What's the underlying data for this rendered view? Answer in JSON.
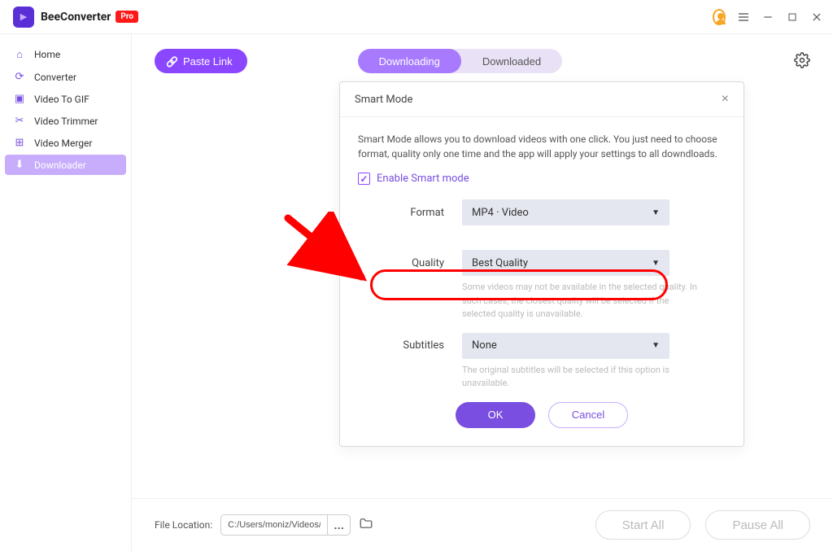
{
  "app": {
    "name": "BeeConverter",
    "badge": "Pro"
  },
  "sidebar": {
    "items": [
      {
        "label": "Home"
      },
      {
        "label": "Converter"
      },
      {
        "label": "Video To GIF"
      },
      {
        "label": "Video Trimmer"
      },
      {
        "label": "Video Merger"
      },
      {
        "label": "Downloader"
      }
    ]
  },
  "toolbar": {
    "paste_label": "Paste Link",
    "tab_downloading": "Downloading",
    "tab_downloaded": "Downloaded"
  },
  "modal": {
    "title": "Smart Mode",
    "description": "Smart Mode allows you to download videos with one click. You just need to choose format, quality only one time and the app will apply your settings to all downdloads.",
    "enable_label": "Enable Smart mode",
    "format_label": "Format",
    "format_value": "MP4 · Video",
    "quality_label": "Quality",
    "quality_value": "Best Quality",
    "quality_help": "Some videos may not be available in the selected quality. In such cases, the closest  quality will be selected if the selected quality is unavailable.",
    "subtitles_label": "Subtitles",
    "subtitles_value": "None",
    "subtitles_help": "The original subtitles will be selected if this option is unavailable.",
    "ok": "OK",
    "cancel": "Cancel"
  },
  "footer": {
    "label": "File Location:",
    "path": "C:/Users/moniz/Videos/B",
    "start_all": "Start All",
    "pause_all": "Pause All"
  }
}
